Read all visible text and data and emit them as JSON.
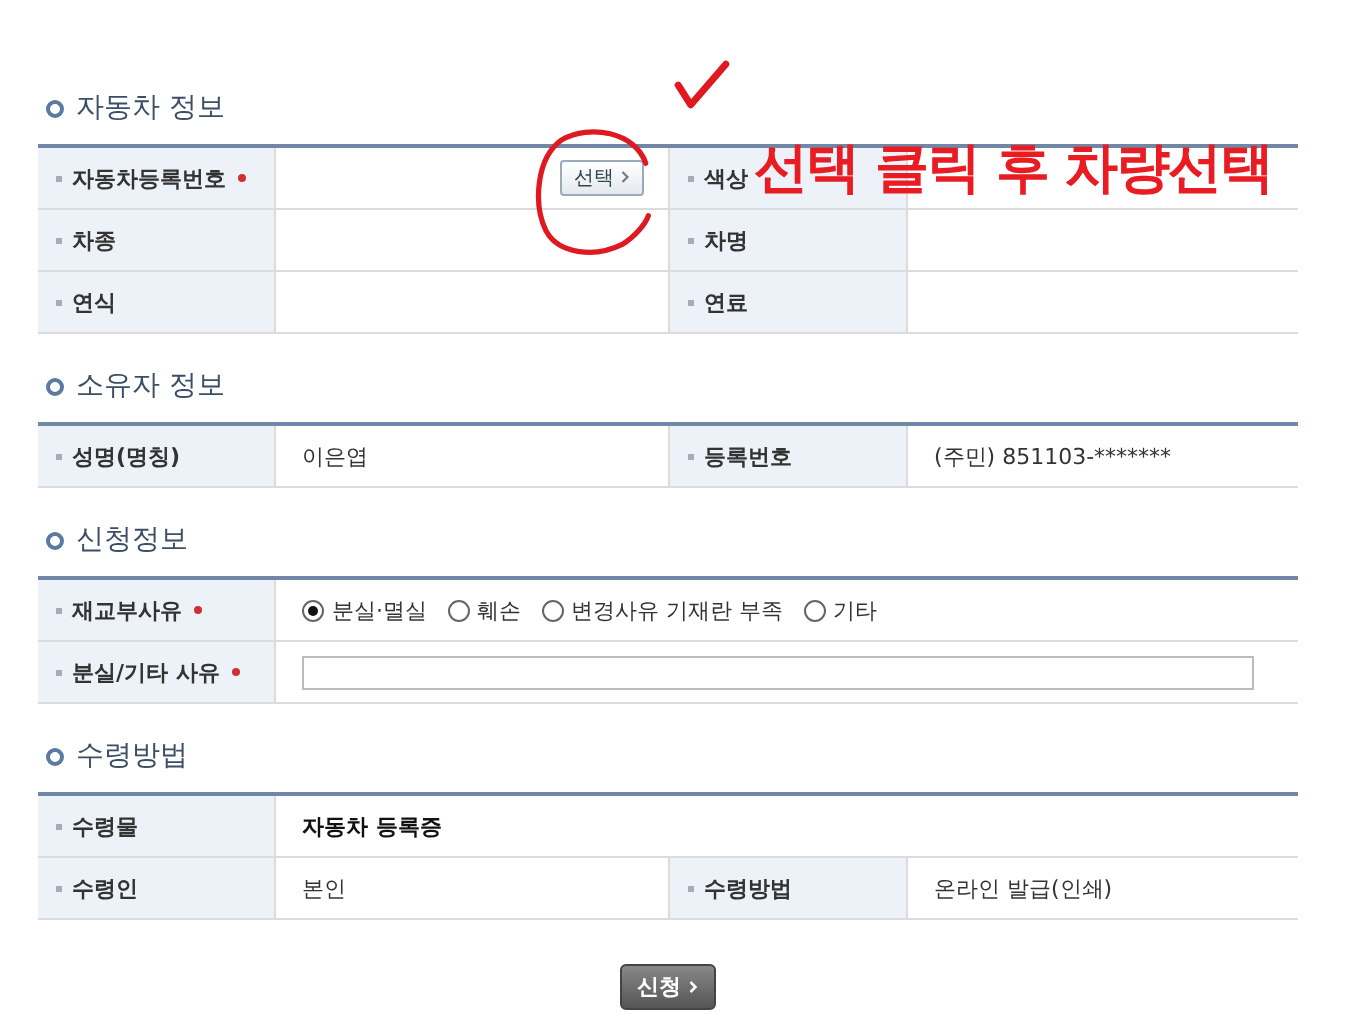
{
  "sections": [
    {
      "title": "자동차 정보",
      "rows": [
        {
          "fields": [
            {
              "label": "자동차등록번호",
              "required": true,
              "value": {
                "kind": "button",
                "text": "선택"
              }
            },
            {
              "label": "색상",
              "required": false,
              "value": {
                "kind": "empty"
              }
            }
          ]
        },
        {
          "fields": [
            {
              "label": "차종",
              "required": false,
              "value": {
                "kind": "empty"
              }
            },
            {
              "label": "차명",
              "required": false,
              "value": {
                "kind": "empty"
              }
            }
          ]
        },
        {
          "fields": [
            {
              "label": "연식",
              "required": false,
              "value": {
                "kind": "empty"
              }
            },
            {
              "label": "연료",
              "required": false,
              "value": {
                "kind": "empty"
              }
            }
          ]
        }
      ]
    },
    {
      "title": "소유자 정보",
      "rows": [
        {
          "fields": [
            {
              "label": "성명(명칭)",
              "required": false,
              "value": {
                "kind": "text",
                "text": "이은엽"
              }
            },
            {
              "label": "등록번호",
              "required": false,
              "value": {
                "kind": "text",
                "text": "(주민) 851103-*******"
              }
            }
          ]
        }
      ]
    },
    {
      "title": "신청정보",
      "rows": [
        {
          "fields": [
            {
              "label": "재교부사유",
              "required": true,
              "value": {
                "kind": "radios",
                "options": [
                  {
                    "label": "분실·멸실",
                    "selected": true
                  },
                  {
                    "label": "훼손",
                    "selected": false
                  },
                  {
                    "label": "변경사유 기재란 부족",
                    "selected": false
                  },
                  {
                    "label": "기타",
                    "selected": false
                  }
                ]
              }
            }
          ]
        },
        {
          "fields": [
            {
              "label": "분실/기타 사유",
              "required": true,
              "value": {
                "kind": "input"
              }
            }
          ]
        }
      ]
    },
    {
      "title": "수령방법",
      "rows": [
        {
          "fields": [
            {
              "label": "수령물",
              "required": false,
              "value": {
                "kind": "bold",
                "text": "자동차 등록증"
              }
            }
          ]
        },
        {
          "fields": [
            {
              "label": "수령인",
              "required": false,
              "value": {
                "kind": "text",
                "text": "본인"
              }
            },
            {
              "label": "수령방법",
              "required": false,
              "value": {
                "kind": "text",
                "text": "온라인 발급(인쇄)"
              }
            }
          ]
        }
      ]
    }
  ],
  "submit": "신청",
  "annotation": {
    "text": "선택 클릭 후 차량선택"
  }
}
